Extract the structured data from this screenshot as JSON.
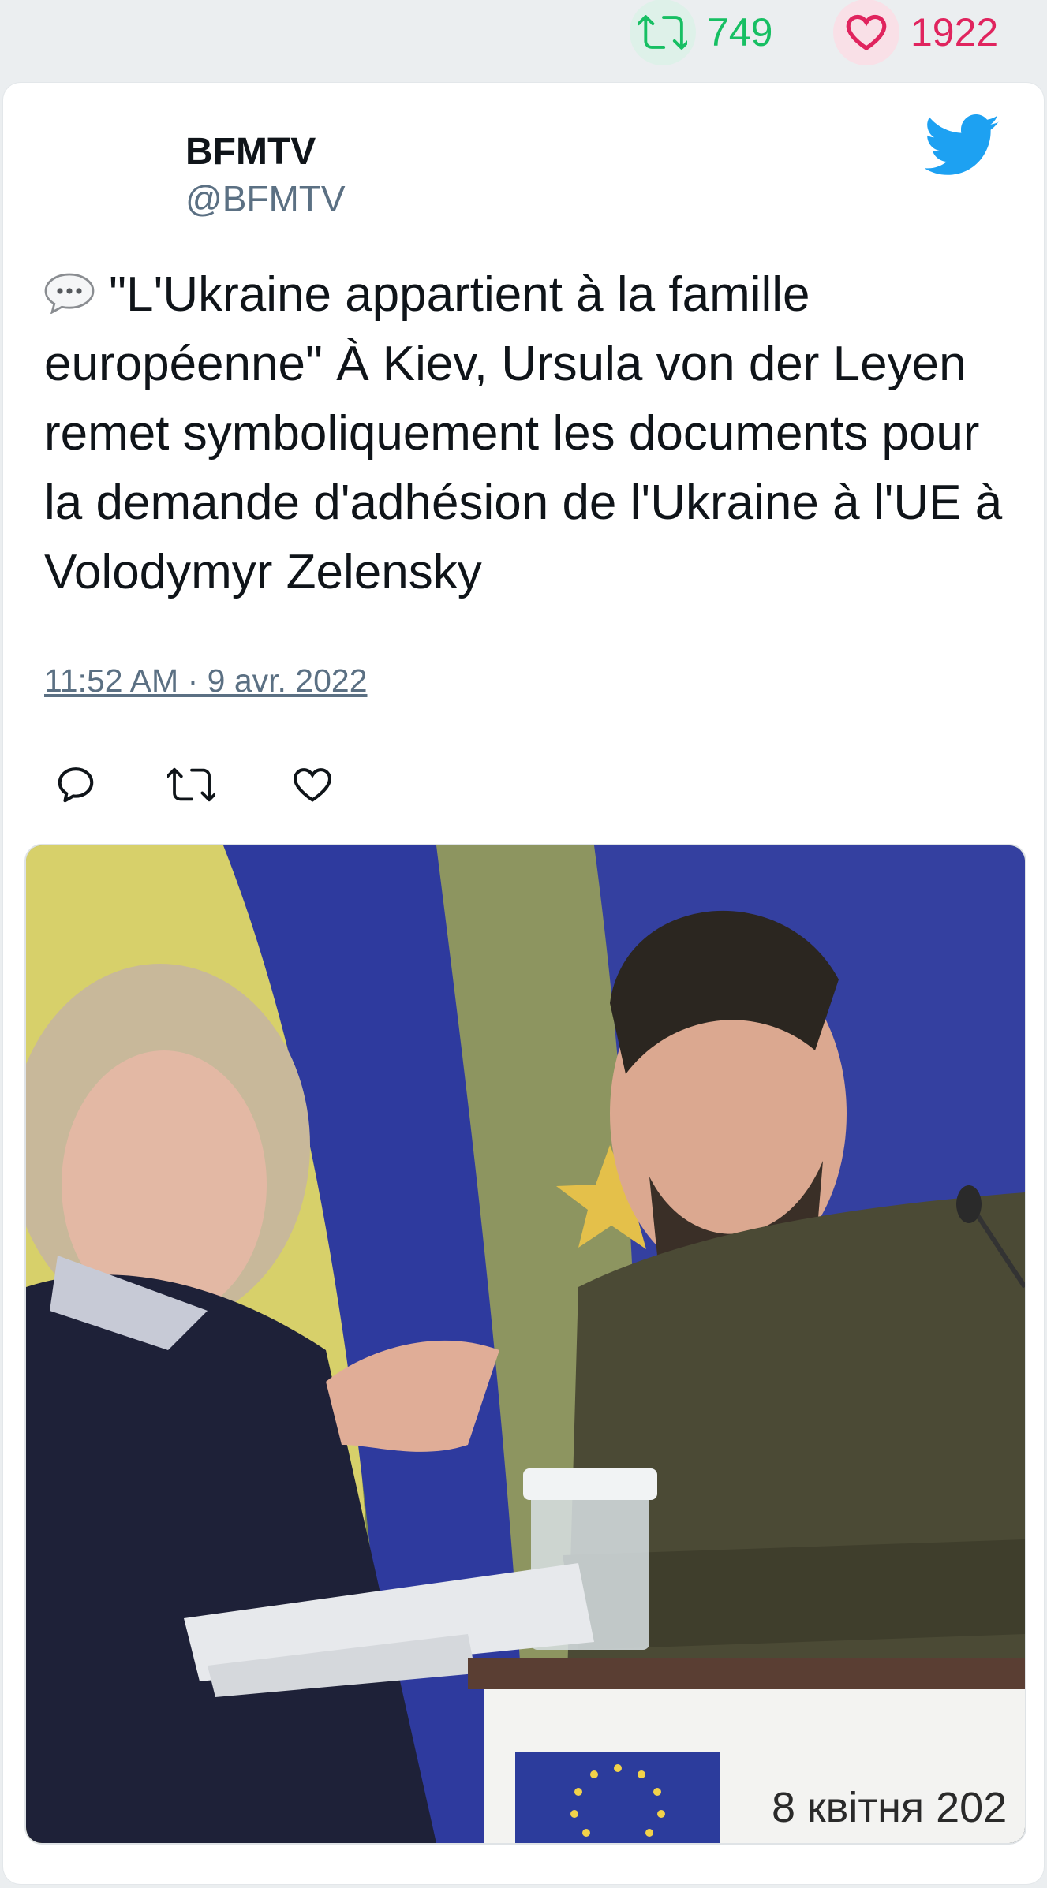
{
  "stats": {
    "retweets": "749",
    "likes": "1922"
  },
  "author": {
    "display_name": "BFMTV",
    "handle": "@BFMTV"
  },
  "tweet": {
    "emoji": "speech-balloon-icon",
    "text": "\"L'Ukraine appartient à la famille européenne\" À Kiev, Ursula von der Leyen remet symboliquement les documents pour la demande d'adhésion de l'Ukraine à l'UE à Volodymyr Zelensky",
    "timestamp": "11:52 AM · 9 avr. 2022"
  },
  "media": {
    "caption_overlay": "8 квітня 202"
  },
  "icons": {
    "retweet": "retweet-icon",
    "like": "heart-icon",
    "reply": "reply-icon",
    "brand": "twitter-bird-icon"
  },
  "colors": {
    "retweet_green": "#17bf63",
    "like_red": "#e0245e",
    "twitter_blue": "#1da1f2",
    "secondary_text": "#5b7083"
  }
}
